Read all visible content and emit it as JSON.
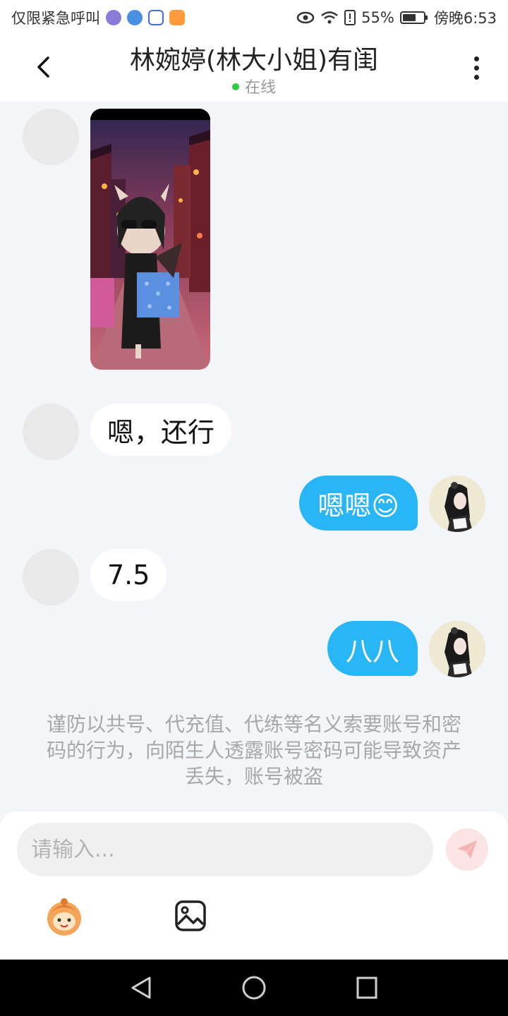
{
  "status_bar": {
    "carrier": "仅限紧急呼叫",
    "battery": "55%",
    "time": "傍晚6:53",
    "icons": [
      "music-app-icon",
      "browser-app-icon",
      "baidu-app-icon",
      "video-app-icon",
      "eye-icon",
      "wifi-icon",
      "sim-icon",
      "battery-icon"
    ]
  },
  "header": {
    "title": "林婉婷(林大小姐)有闺",
    "status": "在线"
  },
  "messages": [
    {
      "from": "peer",
      "type": "image"
    },
    {
      "from": "peer",
      "type": "text",
      "text": "嗯，还行"
    },
    {
      "from": "me",
      "type": "text",
      "text": "嗯嗯😊"
    },
    {
      "from": "peer",
      "type": "text",
      "text": "7.5"
    },
    {
      "from": "me",
      "type": "text",
      "text": "八八"
    }
  ],
  "notice": "谨防以共号、代充值、代练等名义索要账号和密码的行为，向陌生人透露账号密码可能导致资产丢失，账号被盗",
  "composer": {
    "placeholder": "请输入..."
  },
  "colors": {
    "outgoing_bubble": "#29b6f6",
    "incoming_bubble": "#ffffff",
    "online_dot": "#2ecc40",
    "send_button": "#fde4e4"
  }
}
